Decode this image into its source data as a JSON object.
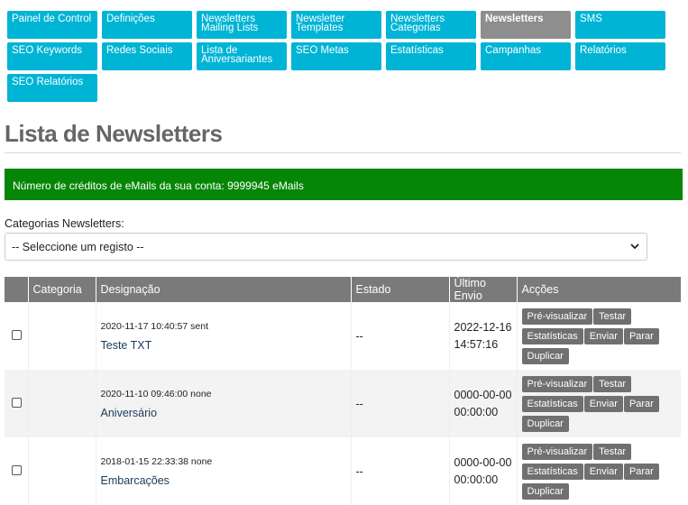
{
  "nav": [
    {
      "label": "Painel de Control",
      "active": false
    },
    {
      "label": "Definições",
      "active": false
    },
    {
      "label": "Newsletters Mailing Lists",
      "active": false
    },
    {
      "label": "Newsletter Templates",
      "active": false
    },
    {
      "label": "Newsletters Categorias",
      "active": false
    },
    {
      "label": "Newsletters",
      "active": true
    },
    {
      "label": "SMS",
      "active": false
    },
    {
      "label": "SEO Keywords",
      "active": false
    },
    {
      "label": "Redes Sociais",
      "active": false
    },
    {
      "label": "Lista de Aniversariantes",
      "active": false
    },
    {
      "label": "SEO Metas",
      "active": false
    },
    {
      "label": "Estatísticas",
      "active": false
    },
    {
      "label": "Campanhas",
      "active": false
    },
    {
      "label": "Relatórios",
      "active": false
    },
    {
      "label": "SEO Relatórios",
      "active": false
    }
  ],
  "page_title": "Lista de Newsletters",
  "credits_text": "Número de créditos de eMails da sua conta: 9999945 eMails",
  "filter": {
    "label": "Categorias Newsletters:",
    "selected": "-- Seleccione um registo --"
  },
  "table": {
    "headers": [
      "",
      "Categoria",
      "Designação",
      "Estado",
      "Último Envio",
      "Acções"
    ],
    "rows": [
      {
        "categoria": "",
        "meta": "2020-11-17 10:40:57 sent",
        "name": "Teste TXT",
        "estado": "--",
        "envio_date": "2022-12-16",
        "envio_time": "14:57:16"
      },
      {
        "categoria": "",
        "meta": "2020-11-10 09:46:00 none",
        "name": "Aniversário",
        "estado": "--",
        "envio_date": "0000-00-00",
        "envio_time": "00:00:00"
      },
      {
        "categoria": "",
        "meta": "2018-01-15 22:33:38 none",
        "name": "Embarcações",
        "estado": "--",
        "envio_date": "0000-00-00",
        "envio_time": "00:00:00"
      }
    ],
    "actions": [
      "Pré-visualizar",
      "Testar",
      "Estatísticas",
      "Enviar",
      "Parar",
      "Duplicar"
    ]
  },
  "colors": {
    "nav": "#00b4d6",
    "nav_active": "#8e8e8e",
    "credits_bg": "#068606",
    "header_bg": "#7a7a7a",
    "action_btn": "#707070"
  },
  "icons": {
    "select": "chevron-down-icon"
  }
}
